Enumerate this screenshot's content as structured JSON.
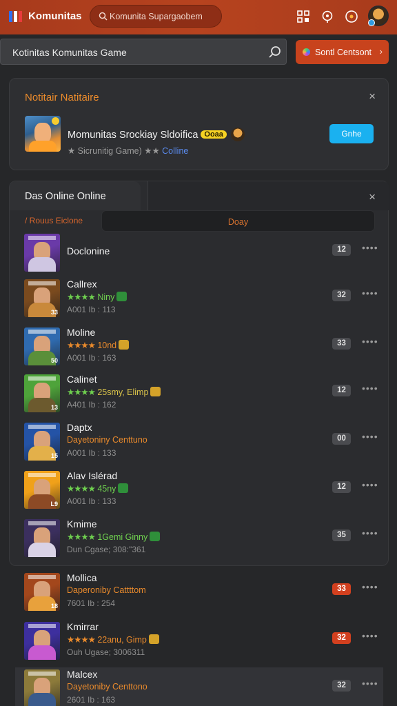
{
  "topbar": {
    "brand": "Komunitas",
    "search_text": "Komunita Supargaobem",
    "icons": [
      "logo-icon",
      "search-icon",
      "grid-icon",
      "support-icon",
      "notifications-icon",
      "user-avatar"
    ]
  },
  "subbar": {
    "search_text": "Kotinitas Komunitas Game",
    "button_label": "Sontl Centsont",
    "button_chevron": "›"
  },
  "notification": {
    "title": "Notitair Natitaire",
    "close": "×",
    "game_name": "Momunitas Srockiay Sldoifica",
    "game_tag": "Ooaa",
    "game_sub_prefix": "★ Sicrunitig Game) ★★",
    "game_sub_link": "Colline",
    "button_label": "Gnhe"
  },
  "panel": {
    "tab_label": "Das Online Online",
    "close": "×",
    "filter_label": "/  Rouus Eiclone",
    "day_label": "Doay"
  },
  "friends": [
    {
      "name": "Doclonine",
      "stars": "",
      "status": "",
      "status_color": "",
      "meta": "",
      "count": "12",
      "count_red": false,
      "more": "••••",
      "thumb": "#6a3aa8",
      "thumb2": "#cfc6e2",
      "thumb_num": ""
    },
    {
      "name": "Callrex",
      "stars": "★★★★",
      "status": "Niny",
      "status_color": "green",
      "meta": "A001 Ib : 113",
      "count": "32",
      "count_red": false,
      "more": "••••",
      "thumb": "#7a4a1e",
      "thumb2": "#c9893b",
      "thumb_num": "33"
    },
    {
      "name": "Moline",
      "stars": "★★★★",
      "status": "10nd",
      "status_color": "orange",
      "meta": "A001 Ib : 163",
      "count": "33",
      "count_red": false,
      "more": "••••",
      "thumb": "#2f6bb0",
      "thumb2": "#5a8f3a",
      "thumb_num": "50"
    },
    {
      "name": "Calinet",
      "stars": "★★★★",
      "status": "25smy, Elimp",
      "status_color": "yellow",
      "meta": "A401 Ib : 162",
      "count": "12",
      "count_red": false,
      "more": "••••",
      "thumb": "#4ea33a",
      "thumb2": "#6c5a2e",
      "thumb_num": "13"
    },
    {
      "name": "Daptx",
      "stars": "",
      "status": "Dayetoniny Centtuno",
      "status_color": "orange",
      "meta": "A001 Ib : 133",
      "count": "00",
      "count_red": false,
      "more": "••••",
      "thumb": "#2453a6",
      "thumb2": "#e3b04a",
      "thumb_num": "15"
    },
    {
      "name": "Alav Islérad",
      "stars": "★★★★",
      "status": "45ny",
      "status_color": "green",
      "meta": "A001 Ib : 133",
      "count": "12",
      "count_red": false,
      "more": "••••",
      "thumb": "#f0a11a",
      "thumb2": "#8c4a25",
      "thumb_num": "L9"
    },
    {
      "name": "Kmime",
      "stars": "★★★★",
      "status": "1Gemi Ginny",
      "status_color": "green",
      "meta": "Dun Cgase; 308:\"361",
      "count": "35",
      "count_red": false,
      "more": "••••",
      "thumb": "#3b2f5e",
      "thumb2": "#d9d2e6",
      "thumb_num": ""
    },
    {
      "name": "Mollica",
      "stars": "",
      "status": "Daperoniby Cattttom",
      "status_color": "orange",
      "meta": "7601 Ib : 254",
      "count": "33",
      "count_red": true,
      "more": "••••",
      "thumb": "#a3471c",
      "thumb2": "#e8a13c",
      "thumb_num": "18"
    },
    {
      "name": "Kmirrar",
      "stars": "★★★★",
      "status": "22anu, Gimp",
      "status_color": "orange",
      "meta": "Ouh Ugase; 3006311",
      "count": "32",
      "count_red": true,
      "more": "••••",
      "thumb": "#3d2f9e",
      "thumb2": "#c85ad0",
      "thumb_num": ""
    },
    {
      "name": "Malcex",
      "stars": "",
      "status": "Dayetoniby Centtono",
      "status_color": "orange",
      "meta": "2601 Ib : 163",
      "count": "32",
      "count_red": false,
      "more": "••••",
      "thumb": "#8c7a3a",
      "thumb2": "#3a5a8c",
      "thumb_num": ""
    }
  ]
}
